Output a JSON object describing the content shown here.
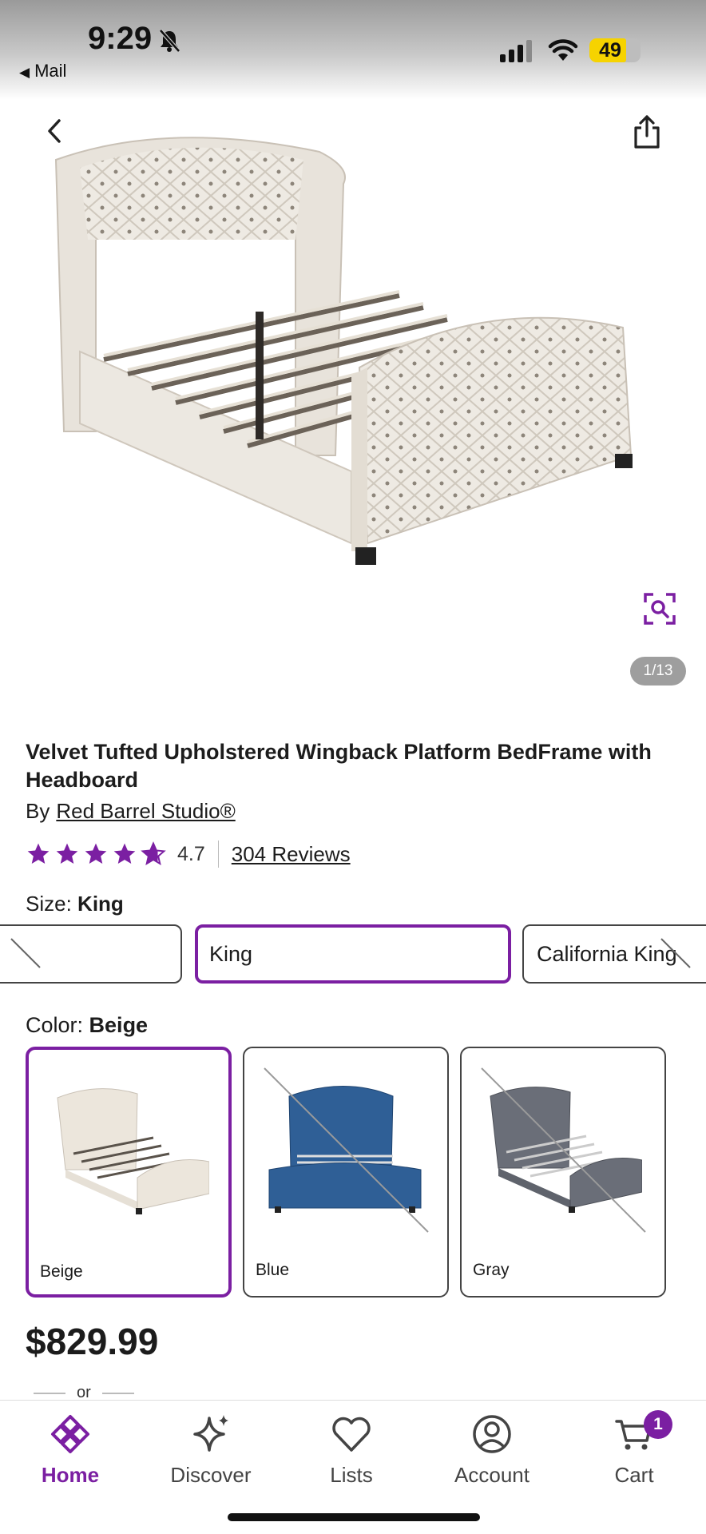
{
  "status_bar": {
    "time": "9:29",
    "back_app": "Mail",
    "battery": "49",
    "battery_color": "#f6d300"
  },
  "product": {
    "image_counter": "1/13",
    "title": "Velvet Tufted Upholstered Wingback Platform BedFrame with Headboard",
    "by_label": "By",
    "brand": "Red Barrel Studio®",
    "rating_value": "4.7",
    "rating_stars": 4.7,
    "reviews": "304 Reviews",
    "size_label": "Size:",
    "size_selected": "King",
    "sizes": [
      {
        "label": "",
        "available": false
      },
      {
        "label": "King",
        "available": true
      },
      {
        "label": "California King",
        "available": false
      }
    ],
    "color_label": "Color:",
    "color_selected": "Beige",
    "colors": [
      {
        "name": "Beige",
        "hex": "#ece6dc",
        "available": true
      },
      {
        "name": "Blue",
        "hex": "#2f5f96",
        "available": false
      },
      {
        "name": "Gray",
        "hex": "#6a6e78",
        "available": false
      }
    ],
    "price": "$829.99",
    "or_text": "or"
  },
  "tabbar": {
    "items": [
      {
        "label": "Home",
        "icon": "home-icon",
        "active": true
      },
      {
        "label": "Discover",
        "icon": "sparkle-icon",
        "active": false
      },
      {
        "label": "Lists",
        "icon": "heart-icon",
        "active": false
      },
      {
        "label": "Account",
        "icon": "account-icon",
        "active": false
      },
      {
        "label": "Cart",
        "icon": "cart-icon",
        "active": false
      }
    ],
    "cart_count": "1"
  },
  "colors": {
    "accent": "#7b1fa2"
  }
}
